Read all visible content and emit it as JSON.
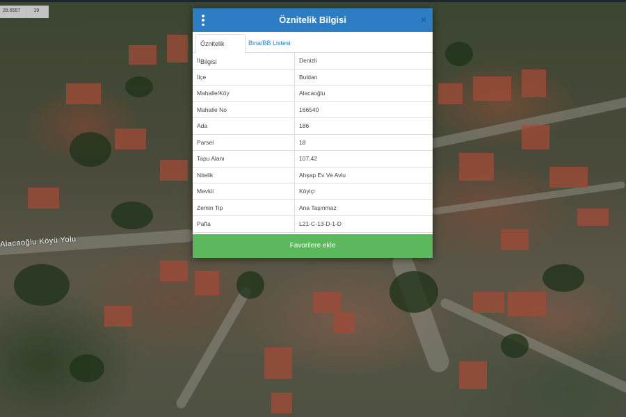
{
  "map": {
    "road_label": "Alacaoğlu Köyü Yolu",
    "coords": {
      "lon": "28.6557",
      "zoom": "19"
    }
  },
  "dialog": {
    "title": "Öznitelik Bilgisi",
    "close_glyph": "×",
    "tabs": [
      {
        "label": "Öznitelik Bilgisi",
        "active": true
      },
      {
        "label": "Bina/BB Listesi",
        "active": false
      }
    ],
    "rows": [
      {
        "key": "İl",
        "value": "Denizli"
      },
      {
        "key": "İlçe",
        "value": "Buldan"
      },
      {
        "key": "Mahalle/Köy",
        "value": "Alacaoğlu"
      },
      {
        "key": "Mahalle No",
        "value": "166540"
      },
      {
        "key": "Ada",
        "value": "186"
      },
      {
        "key": "Parsel",
        "value": "18"
      },
      {
        "key": "Tapu Alanı",
        "value": "107,42"
      },
      {
        "key": "Nitelik",
        "value": "Ahşap Ev Ve Avlu"
      },
      {
        "key": "Mevkii",
        "value": "Köyiçi"
      },
      {
        "key": "Zemin Tip",
        "value": "Ana Taşınmaz"
      },
      {
        "key": "Pafta",
        "value": "L21-C-13-D-1-D"
      }
    ],
    "favorite_button": "Favorilere ekle"
  },
  "colors": {
    "header": "#2c7dc4",
    "favorite": "#5cb85c",
    "tab_link": "#2c7dc4"
  }
}
